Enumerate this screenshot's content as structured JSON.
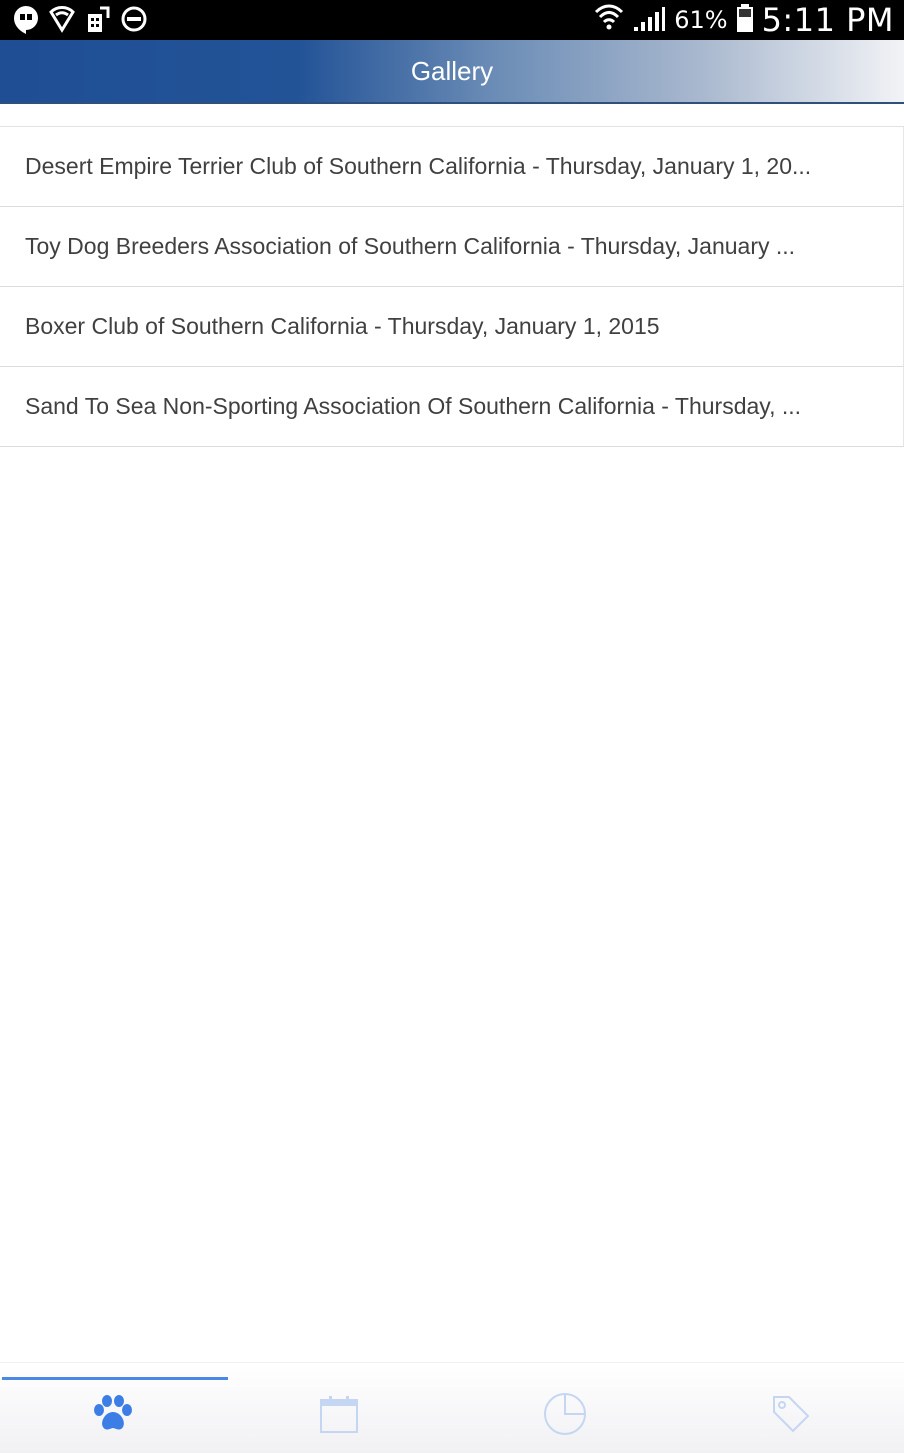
{
  "status_bar": {
    "battery_percent": "61%",
    "time": "5:11 PM",
    "left_icons": [
      "hangouts-icon",
      "wifi-shield-icon",
      "keypad-lock-icon",
      "do-not-disturb-icon"
    ],
    "right_icons": [
      "wifi-icon",
      "signal-icon",
      "battery-icon"
    ]
  },
  "header": {
    "title": "Gallery"
  },
  "gallery": {
    "items": [
      {
        "label": "Desert Empire Terrier Club of Southern California - Thursday, January 1, 20..."
      },
      {
        "label": "Toy Dog Breeders Association of Southern California - Thursday, January ..."
      },
      {
        "label": "Boxer Club of Southern California - Thursday, January 1, 2015"
      },
      {
        "label": "Sand To Sea Non-Sporting Association Of Southern California - Thursday, ..."
      }
    ]
  },
  "tab_bar": {
    "tabs": [
      {
        "icon": "paw-icon",
        "active": true
      },
      {
        "icon": "calendar-icon",
        "active": false
      },
      {
        "icon": "pie-chart-icon",
        "active": false
      },
      {
        "icon": "tag-icon",
        "active": false
      }
    ],
    "active_color": "#3d7ee6",
    "inactive_color": "#c5d6f3"
  }
}
